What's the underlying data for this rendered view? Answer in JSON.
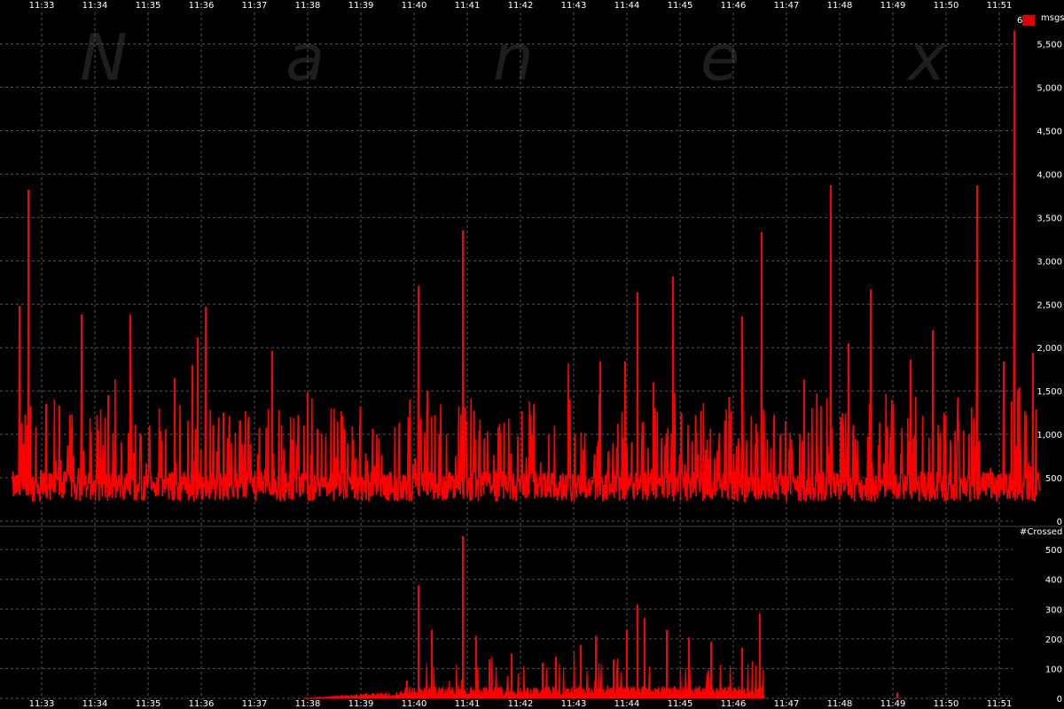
{
  "chart_data": {
    "type": "line",
    "watermark": [
      "N",
      "a",
      "n",
      "e",
      "x"
    ],
    "time_ticks": [
      "11:33",
      "11:34",
      "11:35",
      "11:36",
      "11:37",
      "11:38",
      "11:39",
      "11:40",
      "11:41",
      "11:42",
      "11:43",
      "11:44",
      "11:45",
      "11:46",
      "11:47",
      "11:48",
      "11:49",
      "11:50",
      "11:51"
    ],
    "grid": true,
    "legend_marker": {
      "label": "6",
      "color": "#e00000"
    },
    "panels": [
      {
        "id": "msgs",
        "ylabel": "msgs",
        "ylim": [
          0,
          5700
        ],
        "yticks": [
          0,
          500,
          1000,
          1500,
          2000,
          2500,
          3000,
          3500,
          4000,
          4500,
          5000,
          5500
        ],
        "ytick_labels": [
          "0",
          "500",
          "1,000",
          "1,500",
          "2,000",
          "2,500",
          "3,000",
          "3,500",
          "4,000",
          "4,500",
          "5,000",
          "5,500"
        ],
        "series": [
          {
            "color": "#ff0000",
            "baseline": 500,
            "spikes": [
              [
                "11:32:35",
                2480
              ],
              [
                "11:32:45",
                3820
              ],
              [
                "11:33:05",
                1350
              ],
              [
                "11:33:20",
                1330
              ],
              [
                "11:33:45",
                2380
              ],
              [
                "11:34:15",
                1450
              ],
              [
                "11:34:40",
                2380
              ],
              [
                "11:35:30",
                1650
              ],
              [
                "11:35:50",
                1800
              ],
              [
                "11:35:56",
                2120
              ],
              [
                "11:36:05",
                2470
              ],
              [
                "11:36:25",
                1250
              ],
              [
                "11:37:20",
                1960
              ],
              [
                "11:38:00",
                1480
              ],
              [
                "11:40:05",
                2710
              ],
              [
                "11:40:15",
                1500
              ],
              [
                "11:40:55",
                3350
              ],
              [
                "11:43:30",
                1840
              ],
              [
                "11:43:58",
                1840
              ],
              [
                "11:44:12",
                2640
              ],
              [
                "11:44:30",
                1600
              ],
              [
                "11:44:52",
                2820
              ],
              [
                "11:46:10",
                2360
              ],
              [
                "11:46:32",
                3330
              ],
              [
                "11:47:20",
                1630
              ],
              [
                "11:47:50",
                3870
              ],
              [
                "11:48:10",
                2050
              ],
              [
                "11:48:35",
                2670
              ],
              [
                "11:49:20",
                1860
              ],
              [
                "11:49:45",
                2200
              ],
              [
                "11:50:35",
                3870
              ],
              [
                "11:51:05",
                1840
              ],
              [
                "11:51:17",
                5650
              ],
              [
                "11:51:22",
                1500
              ],
              [
                "11:51:38",
                1940
              ]
            ]
          }
        ]
      },
      {
        "id": "crossed",
        "ylabel": "#Crossed",
        "ylim": [
          0,
          560
        ],
        "yticks": [
          0,
          100,
          200,
          300,
          400,
          500
        ],
        "ytick_labels": [
          "0",
          "100",
          "200",
          "300",
          "400",
          "500"
        ],
        "series": [
          {
            "color": "#ff0000",
            "active_range": [
              "11:37:55",
              "11:46:35"
            ],
            "spikes": [
              [
                "11:39:52",
                60
              ],
              [
                "11:40:05",
                380
              ],
              [
                "11:40:20",
                230
              ],
              [
                "11:40:55",
                545
              ],
              [
                "11:41:10",
                210
              ],
              [
                "11:41:25",
                130
              ],
              [
                "11:41:50",
                150
              ],
              [
                "11:42:25",
                120
              ],
              [
                "11:42:40",
                140
              ],
              [
                "11:43:08",
                180
              ],
              [
                "11:43:25",
                210
              ],
              [
                "11:43:45",
                130
              ],
              [
                "11:44:00",
                230
              ],
              [
                "11:44:12",
                315
              ],
              [
                "11:44:20",
                270
              ],
              [
                "11:44:45",
                230
              ],
              [
                "11:45:10",
                205
              ],
              [
                "11:45:35",
                190
              ],
              [
                "11:46:10",
                170
              ],
              [
                "11:46:30",
                285
              ],
              [
                "11:49:05",
                20
              ]
            ]
          }
        ]
      }
    ]
  }
}
